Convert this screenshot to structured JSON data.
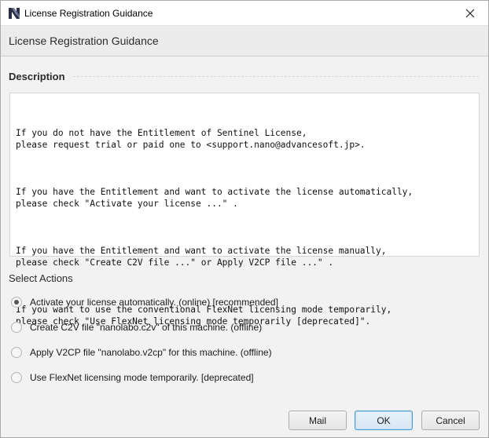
{
  "window": {
    "title": "License Registration Guidance",
    "app_icon": "nanolabo-n-logo-icon",
    "close_icon": "close-icon"
  },
  "header": {
    "title": "License Registration Guidance"
  },
  "description": {
    "section_title": "Description",
    "paragraphs": [
      "If you do not have the Entitlement of Sentinel License,\nplease request trial or paid one to <support.nano@advancesoft.jp>.",
      "If you have the Entitlement and want to activate the license automatically,\nplease check \"Activate your license ...\" .",
      "If you have the Entitlement and want to activate the license manually,\nplease check \"Create C2V file ...\" or Apply V2CP file ...\" .",
      "If you want to use the conventional FlexNet licensing mode temporarily,\nplease check \"Use FlexNet licensing mode temporarily [deprecated]\"."
    ]
  },
  "actions": {
    "section_title": "Select Actions",
    "options": [
      {
        "label": "Activate your license automatically. (online) [recommended]",
        "selected": true
      },
      {
        "label": "Create C2V file \"nanolabo.c2v\" of this machine. (offline)",
        "selected": false
      },
      {
        "label": "Apply V2CP file \"nanolabo.v2cp\" for this machine. (offline)",
        "selected": false
      },
      {
        "label": "Use FlexNet licensing mode temporarily. [deprecated]",
        "selected": false
      }
    ]
  },
  "buttons": {
    "mail": "Mail",
    "ok": "OK",
    "cancel": "Cancel"
  },
  "colors": {
    "default_button_border": "#4a9ad6",
    "background": "#f2f2f2"
  }
}
